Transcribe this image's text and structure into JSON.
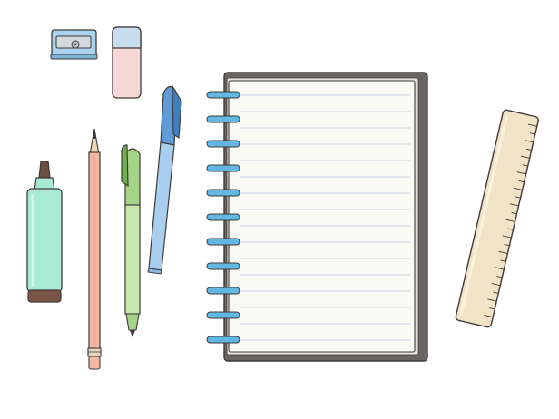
{
  "scene": {
    "background": "#ffffff",
    "objects": [
      {
        "name": "pencil-sharpener",
        "color": "#a9d3ee"
      },
      {
        "name": "eraser",
        "color": "#f7d6d6"
      },
      {
        "name": "highlighter",
        "color": "#a8ead4"
      },
      {
        "name": "pencil",
        "color": "#f3b8a3"
      },
      {
        "name": "green-pen",
        "color": "#a5d488"
      },
      {
        "name": "blue-pen",
        "color": "#8ab9e6"
      },
      {
        "name": "spiral-notebook",
        "color": "#f9f9f6"
      },
      {
        "name": "ruler",
        "color": "#f2e3c6"
      }
    ],
    "accent_colors": {
      "spiral_rings": "#63b7e3",
      "notebook_cover": "#6b6561",
      "page_lines": "#c9d4e8",
      "outline": "#3f3a38"
    }
  }
}
